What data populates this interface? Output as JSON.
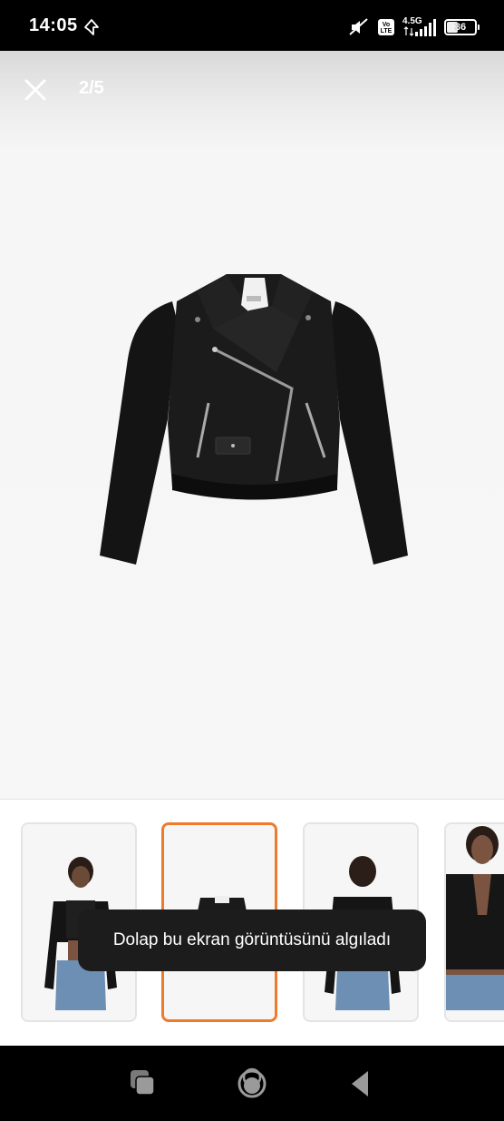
{
  "status_bar": {
    "time": "14:05",
    "network": "4.5G",
    "volte": "Vo LTE",
    "battery": "36"
  },
  "viewer": {
    "counter": "2/5",
    "close_icon": "close-icon",
    "image": "black-leather-biker-jacket-product-photo"
  },
  "thumbnails": [
    {
      "name": "model-front-photo",
      "selected": false
    },
    {
      "name": "jacket-product-photo",
      "selected": true
    },
    {
      "name": "model-back-photo",
      "selected": false
    },
    {
      "name": "model-closeup-photo",
      "selected": false
    }
  ],
  "toast": {
    "message": "Dolap bu ekran görüntüsünü algıladı"
  },
  "colors": {
    "accent": "#ef7a2a",
    "toast_bg": "#1c1c1c"
  },
  "system_nav": {
    "recents": "recents-icon",
    "home": "home-icon",
    "back": "back-icon"
  }
}
